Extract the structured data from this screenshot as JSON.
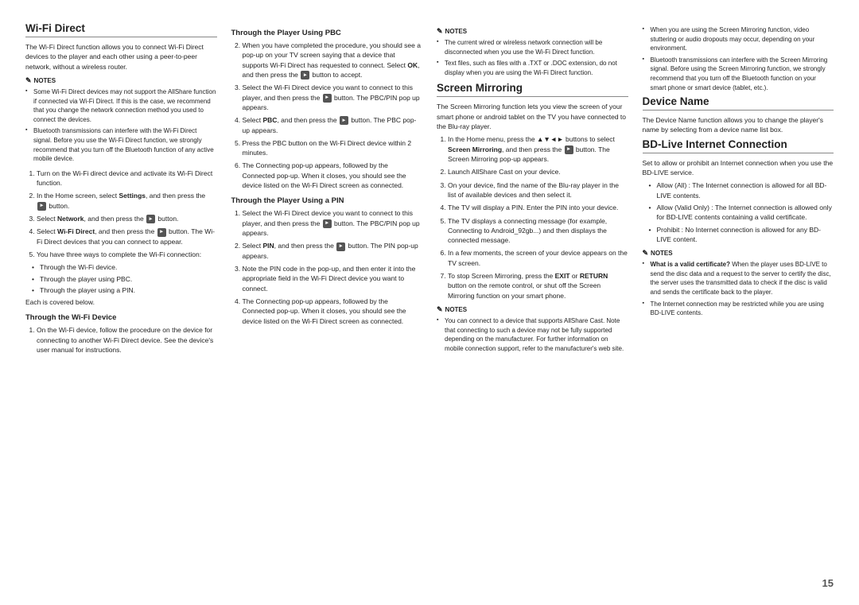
{
  "page": {
    "number": "15"
  },
  "col1": {
    "title": "Wi-Fi Direct",
    "intro": "The Wi-Fi Direct function allows you to connect Wi-Fi Direct devices to the player and each other using a peer-to-peer network, without a wireless router.",
    "notes_label": "NOTES",
    "notes": [
      "Some Wi-Fi Direct devices may not support the AllShare function if connected via Wi-Fi Direct. If this is the case, we recommend that you change the network connection method you used to connect the devices.",
      "Bluetooth transmissions can interfere with the Wi-Fi Direct signal. Before you use the Wi-Fi Direct function, we strongly recommend that you turn off the Bluetooth function of any active mobile device."
    ],
    "steps": [
      "Turn on the Wi-Fi direct device and activate its Wi-Fi Direct function.",
      "In the Home screen, select Settings, and then press the [btn] button.",
      "Select Network, and then press the [btn] button.",
      "Select Wi-Fi Direct, and then press the [btn] button. The Wi-Fi Direct devices that you can connect to appear.",
      "You have three ways to complete the Wi-Fi connection:"
    ],
    "ways": [
      "Through the Wi-Fi device.",
      "Through the player using PBC.",
      "Through the player using a PIN."
    ],
    "ways_note": "Each is covered below.",
    "sub1_title": "Through the Wi-Fi Device",
    "sub1_steps": [
      "On the Wi-Fi device, follow the procedure on the device for connecting to another Wi-Fi Direct device. See the device's user manual for instructions."
    ]
  },
  "col2": {
    "sub2_title": "Through the Player Using PBC",
    "sub2_intro_step": "When you have completed the procedure, you should see a pop-up on your TV screen saying that a device that supports Wi-Fi Direct has requested to connect. Select OK, and then press the [btn] button to accept.",
    "sub2_steps": [
      "Select the Wi-Fi Direct device you want to connect to this player, and then press the [btn] button. The PBC/PIN pop up appears.",
      "Select PBC, and then press the [btn] button. The PBC pop-up appears.",
      "Press the PBC button on the Wi-Fi Direct device within 2 minutes.",
      "The Connecting pop-up appears, followed by the Connected pop-up. When it closes, you should see the device listed on the Wi-Fi Direct screen as connected."
    ],
    "sub3_title": "Through the Player Using a PIN",
    "sub3_steps": [
      "Select the Wi-Fi Direct device you want to connect to this player, and then press the [btn] button. The PBC/PIN pop up appears.",
      "Select PIN, and then press the [btn] button. The PIN pop-up appears.",
      "Note the PIN code in the pop-up, and then enter it into the appropriate field in the Wi-Fi Direct device you want to connect.",
      "The Connecting pop-up appears, followed by the Connected pop-up. When it closes, you should see the device listed on the Wi-Fi Direct screen as connected."
    ]
  },
  "col3": {
    "notes_label": "NOTES",
    "notes_items": [
      "The current wired or wireless network connection will be disconnected when you use the Wi-Fi Direct function.",
      "Text files, such as files with a .TXT or .DOC extension, do not display when you are using the Wi-Fi Direct function."
    ],
    "title": "Screen Mirroring",
    "intro": "The Screen Mirroring function lets you view the screen of your smart phone or android tablet on the TV you have connected to the Blu-ray player.",
    "steps": [
      "In the Home menu, press the ▲▼◄► buttons to select Screen Mirroring, and then press the [btn] button. The Screen Mirroring pop-up appears.",
      "Launch AllShare Cast on your device.",
      "On your device, find the name of the Blu-ray player in the list of available devices and then select it.",
      "The TV will display a PIN. Enter the PIN into your device.",
      "The TV displays a connecting message (for example, Connecting to Android_92gb...) and then displays the connected message.",
      "In a few moments, the screen of your device appears on the TV screen.",
      "To stop Screen Mirroring, press the EXIT or RETURN button on the remote control, or shut off the Screen Mirroring function on your smart phone."
    ],
    "notes2_label": "NOTES",
    "notes2_items": [
      "You can connect to a device that supports AllShare Cast. Note that connecting to such a device may not be fully supported depending on the manufacturer. For further information on mobile connection support, refer to the manufacturer's web site."
    ]
  },
  "col4": {
    "bullet_items": [
      "When you are using the Screen Mirroring function, video stuttering or audio dropouts may occur, depending on your environment.",
      "Bluetooth transmissions can interfere with the Screen Mirroring signal. Before using the Screen Mirroring function, we strongly recommend that you turn off the Bluetooth function on your smart phone or smart device (tablet, etc.)."
    ],
    "device_title": "Device Name",
    "device_intro": "The Device Name function allows you to change the player's name by selecting from a device name list box.",
    "bd_title": "BD-Live Internet Connection",
    "bd_intro": "Set to allow or prohibit an Internet connection when you use the BD-LIVE service.",
    "bd_items": [
      "Allow (All) : The Internet connection is allowed for all BD-LIVE contents.",
      "Allow (Valid Only) : The Internet connection is allowed only for BD-LIVE contents containing a valid certificate.",
      "Prohibit : No Internet connection is allowed for any BD-LIVE content."
    ],
    "notes_label": "NOTES",
    "notes_items": [
      "What is a valid certificate? When the player uses BD-LIVE to send the disc data and a request to the server to certify the disc, the server uses the transmitted data to check if the disc is valid and sends the certificate back to the player.",
      "The Internet connection may be restricted while you are using BD-LIVE contents."
    ]
  }
}
